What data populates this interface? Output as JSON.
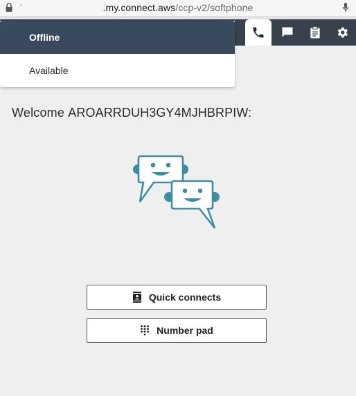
{
  "browser": {
    "url_host": ".my.connect.aws",
    "url_path": "/ccp-v2/softphone"
  },
  "header": {
    "icons": [
      "phone-icon",
      "chat-icon",
      "clipboard-icon",
      "gear-icon"
    ],
    "active_icon": "phone-icon",
    "background": "#37424d"
  },
  "status_menu": {
    "options": [
      {
        "label": "Offline",
        "selected": true
      },
      {
        "label": "Available",
        "selected": false
      }
    ],
    "selected_color": "#3a4a5e"
  },
  "main": {
    "welcome_prefix": "Welcome",
    "username": "AROARRDUH3GY4MJHBRPIW:",
    "illustration": "chat-bots-icon",
    "accent": "#3b8ea5"
  },
  "actions": {
    "quick_connects_label": "Quick connects",
    "number_pad_label": "Number pad"
  }
}
